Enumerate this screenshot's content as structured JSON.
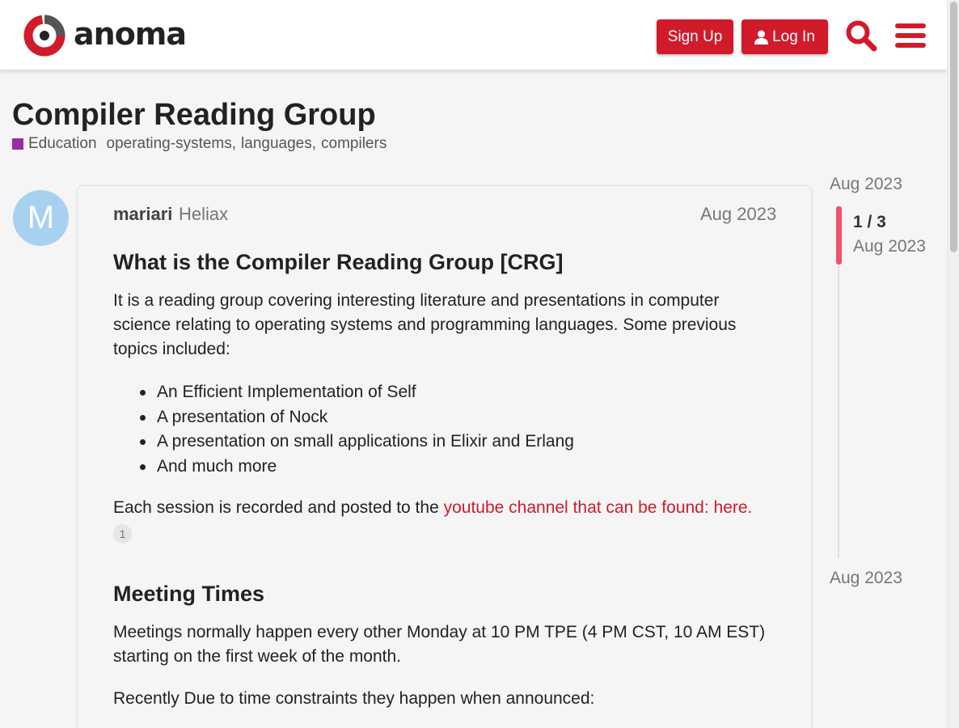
{
  "header": {
    "brand": "anoma",
    "signup_label": "Sign Up",
    "login_label": "Log In",
    "accent_color": "#d11a2a"
  },
  "topic": {
    "title": "Compiler Reading Group",
    "category": "Education",
    "category_color": "#9b2b9b",
    "tags": [
      "operating-systems",
      "languages",
      "compilers"
    ]
  },
  "post": {
    "avatar_letter": "M",
    "username": "mariari",
    "user_title": "Heliax",
    "date": "Aug 2023",
    "heading1": "What is the Compiler Reading Group [CRG]",
    "intro": "It is a reading group covering interesting literature and presentations in computer science relating to operating systems and programming languages. Some previous topics included:",
    "topics": [
      "An Efficient Implementation of Self",
      "A presentation of Nock",
      "A presentation on small applications in Elixir and Erlang",
      "And much more"
    ],
    "session_text": "Each session is recorded and posted to the ",
    "session_link": "youtube channel that can be found: here.",
    "link_clicks": "1",
    "heading2": "Meeting Times",
    "meeting_text": "Meetings normally happen every other Monday at 10 PM TPE (4 PM CST, 10 AM EST) starting on the first week of the month.",
    "recent_text": "Recently Due to time constraints they happen when announced:"
  },
  "timeline": {
    "start_date": "Aug 2023",
    "position": "1 / 3",
    "current_date": "Aug 2023",
    "end_date": "Aug 2023"
  }
}
